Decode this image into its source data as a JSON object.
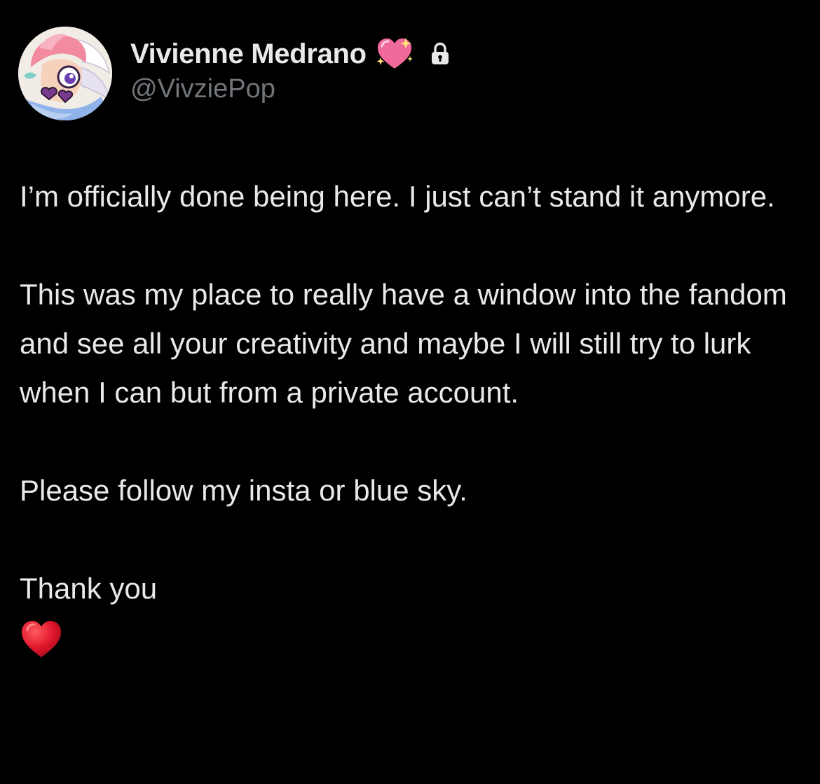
{
  "author": {
    "display_name": "Vivienne Medrano",
    "handle": "@VivziePop",
    "badge_icon": "sparkling-heart-icon",
    "lock_icon": "lock-icon",
    "avatar": "cartoon-character-avatar"
  },
  "post": {
    "paragraphs": [
      "I’m officially done being here. I just can’t stand it anymore.",
      "This was my place to really have a window into the fandom and see all your creativity and maybe I will still try to lurk when I can but from a private account.",
      "Please follow my insta or blue sky.",
      "Thank you"
    ],
    "closing_emoji": "red-heart-icon"
  },
  "colors": {
    "background": "#000000",
    "primary_text": "#e7e9ea",
    "secondary_text": "#71767b",
    "heart_pink": "#f06a9b",
    "heart_red": "#e0162b"
  }
}
